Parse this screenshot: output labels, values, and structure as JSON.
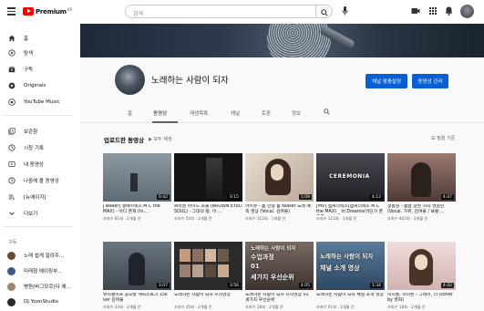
{
  "topbar": {
    "logo_text": "Premium",
    "logo_region": "KR",
    "search_placeholder": "검색"
  },
  "sidebar": {
    "primary": [
      {
        "label": "홈",
        "icon": "home-icon"
      },
      {
        "label": "탐색",
        "icon": "compass-icon"
      },
      {
        "label": "구독",
        "icon": "subscriptions-icon"
      },
      {
        "label": "Originals",
        "icon": "originals-icon"
      },
      {
        "label": "YouTube Music",
        "icon": "music-icon"
      }
    ],
    "library": [
      {
        "label": "보관함",
        "icon": "library-icon"
      },
      {
        "label": "시청 기록",
        "icon": "history-icon"
      },
      {
        "label": "내 동영상",
        "icon": "my-videos-icon"
      },
      {
        "label": "나중에 볼 동영상",
        "icon": "watch-later-icon"
      },
      {
        "label": "[뉴에이지]",
        "icon": "playlist-icon"
      },
      {
        "label": "더보기",
        "icon": "chevron-down-icon"
      }
    ],
    "subscriptions_heading": "구독",
    "subscriptions": [
      {
        "label": "노래 쉽게 알려주...",
        "color": "#6b4a3a"
      },
      {
        "label": "미래형 에이징부...",
        "color": "#3d5a80"
      },
      {
        "label": "병원(바그모르)다 에...",
        "color": "#a0826d"
      },
      {
        "label": "DJ YoonStudio",
        "color": "#2b2b2b"
      }
    ]
  },
  "channel": {
    "name": "노래하는 사람이 되자",
    "customize_label": "채널 맞춤설정",
    "manage_label": "동영상 관리"
  },
  "tabs": [
    "홈",
    "동영상",
    "재생목록",
    "채널",
    "토론",
    "정보"
  ],
  "active_tab": 1,
  "section": {
    "title": "업로드한 동영상",
    "play_all": "모두 재생",
    "sort_label": "정렬 기준"
  },
  "videos_row1": [
    {
      "title": "[Teaser] 앵에이엑스 M.C the MAX) - 어디 존재 (In...",
      "meta": "조회수 81회 · 2개월 전",
      "duration": "0:42",
      "bg": "#6e7b86"
    },
    {
      "title": "브라운 아이드 소울 (BROWN EYED SOUL) - 그대의 방, 이 ...",
      "meta": "조회수 54회 · 2개월 전",
      "duration": "0:15",
      "bg": "#1c1c1c"
    },
    {
      "title": "아이유 - 봄 안녕 봄 teaser 노래 예측 영상 (Vocal. 김여울)",
      "meta": "조회수 312회 · 1개월 전",
      "duration": "1:09",
      "bg": "#d9cfc4"
    },
    {
      "title": "[MV] 엠씨더맥스(엠씨더맥스 M.C the MAX) _ In Dreams(어딘가 존재를...",
      "meta": "조회수 112회 · 1개월 전",
      "duration": "4:12",
      "bg": "#3a3a42"
    },
    {
      "title": "정동원 - 봄날 같은 사자 영원한 (Vocal. 가위, 김여울 / 보컬 ...",
      "meta": "조회수 462회 · 2개월 전",
      "duration": "4:47",
      "bg": "#7a5c5c"
    }
  ],
  "videos_row2": [
    {
      "title": "뮤지컬이프 공모방 캐릭스토크 15k ver 김여울",
      "meta": "조회수 34회 · 2개월 전",
      "duration": "3:07",
      "bg": "#55606a"
    },
    {
      "title": "노래하는 사람이 되자 시작영상",
      "meta": "조회수 45회 · 2개월 전",
      "duration": "3:56",
      "bg": "#2e2e2e"
    },
    {
      "title": "노래하는 사람이 되자 시작영상 01 세가지 우선순위",
      "meta": "조회수 28회 · 2개월 전",
      "duration": "4:05",
      "bg": "#5a4e4a",
      "overlay": [
        "노래하는 사람이 되자",
        "수업과정",
        "01",
        "세가지 우선순위"
      ]
    },
    {
      "title": "노래하는 사람이 되자 채널 소개 영상",
      "meta": "조회수 61회 · 2개월 전",
      "duration": "1:34",
      "bg": "#486a8a",
      "overlay": [
        "노래하는 사람이 되자",
        "채널 소개 영상"
      ]
    },
    {
      "title": "미지통, 미미존 - 그레이, 너 (cover by 영화)",
      "meta": "조회수 18회 · 2개월 전",
      "duration": "4:42",
      "bg": "#e0c8c8"
    }
  ],
  "colors": {
    "brand_red": "#ff0000",
    "accent_blue": "#065fd4"
  }
}
